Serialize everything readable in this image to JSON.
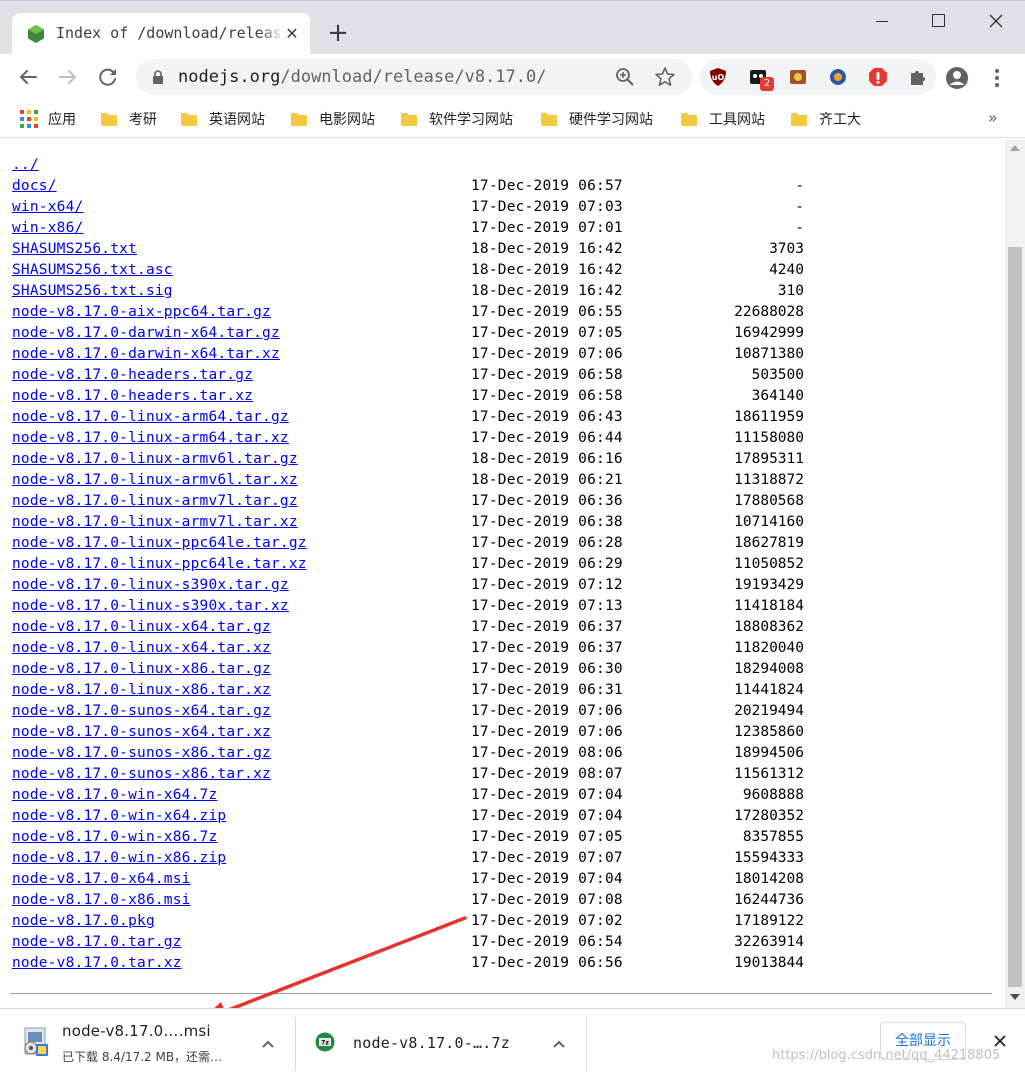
{
  "tab": {
    "title": "Index of /download/release/v8.17.0/",
    "close_icon": "close-icon",
    "favicon": "nodejs-icon"
  },
  "toolbar": {
    "url_host": "nodejs.org",
    "url_path": "/download/release/v8.17.0/",
    "extensions": [
      "ublock-origin-icon",
      "extension-icon",
      "extension-icon",
      "extension-icon",
      "adblock-icon",
      "puzzle-icon"
    ],
    "extension_badge": "2"
  },
  "bookmarks": {
    "apps_label": "应用",
    "items": [
      "考研",
      "英语网站",
      "电影网站",
      "软件学习网站",
      "硬件学习网站",
      "工具网站",
      "齐工大"
    ],
    "more": "»"
  },
  "listing": {
    "parent": "../",
    "rows": [
      {
        "name": "docs/",
        "date": "17-Dec-2019 06:57",
        "size": "-"
      },
      {
        "name": "win-x64/",
        "date": "17-Dec-2019 07:03",
        "size": "-"
      },
      {
        "name": "win-x86/",
        "date": "17-Dec-2019 07:01",
        "size": "-"
      },
      {
        "name": "SHASUMS256.txt",
        "date": "18-Dec-2019 16:42",
        "size": "3703"
      },
      {
        "name": "SHASUMS256.txt.asc",
        "date": "18-Dec-2019 16:42",
        "size": "4240"
      },
      {
        "name": "SHASUMS256.txt.sig",
        "date": "18-Dec-2019 16:42",
        "size": "310"
      },
      {
        "name": "node-v8.17.0-aix-ppc64.tar.gz",
        "date": "17-Dec-2019 06:55",
        "size": "22688028"
      },
      {
        "name": "node-v8.17.0-darwin-x64.tar.gz",
        "date": "17-Dec-2019 07:05",
        "size": "16942999"
      },
      {
        "name": "node-v8.17.0-darwin-x64.tar.xz",
        "date": "17-Dec-2019 07:06",
        "size": "10871380"
      },
      {
        "name": "node-v8.17.0-headers.tar.gz",
        "date": "17-Dec-2019 06:58",
        "size": "503500"
      },
      {
        "name": "node-v8.17.0-headers.tar.xz",
        "date": "17-Dec-2019 06:58",
        "size": "364140"
      },
      {
        "name": "node-v8.17.0-linux-arm64.tar.gz",
        "date": "17-Dec-2019 06:43",
        "size": "18611959"
      },
      {
        "name": "node-v8.17.0-linux-arm64.tar.xz",
        "date": "17-Dec-2019 06:44",
        "size": "11158080"
      },
      {
        "name": "node-v8.17.0-linux-armv6l.tar.gz",
        "date": "18-Dec-2019 06:16",
        "size": "17895311"
      },
      {
        "name": "node-v8.17.0-linux-armv6l.tar.xz",
        "date": "18-Dec-2019 06:21",
        "size": "11318872"
      },
      {
        "name": "node-v8.17.0-linux-armv7l.tar.gz",
        "date": "17-Dec-2019 06:36",
        "size": "17880568"
      },
      {
        "name": "node-v8.17.0-linux-armv7l.tar.xz",
        "date": "17-Dec-2019 06:38",
        "size": "10714160"
      },
      {
        "name": "node-v8.17.0-linux-ppc64le.tar.gz",
        "date": "17-Dec-2019 06:28",
        "size": "18627819"
      },
      {
        "name": "node-v8.17.0-linux-ppc64le.tar.xz",
        "date": "17-Dec-2019 06:29",
        "size": "11050852"
      },
      {
        "name": "node-v8.17.0-linux-s390x.tar.gz",
        "date": "17-Dec-2019 07:12",
        "size": "19193429"
      },
      {
        "name": "node-v8.17.0-linux-s390x.tar.xz",
        "date": "17-Dec-2019 07:13",
        "size": "11418184"
      },
      {
        "name": "node-v8.17.0-linux-x64.tar.gz",
        "date": "17-Dec-2019 06:37",
        "size": "18808362"
      },
      {
        "name": "node-v8.17.0-linux-x64.tar.xz",
        "date": "17-Dec-2019 06:37",
        "size": "11820040"
      },
      {
        "name": "node-v8.17.0-linux-x86.tar.gz",
        "date": "17-Dec-2019 06:30",
        "size": "18294008"
      },
      {
        "name": "node-v8.17.0-linux-x86.tar.xz",
        "date": "17-Dec-2019 06:31",
        "size": "11441824"
      },
      {
        "name": "node-v8.17.0-sunos-x64.tar.gz",
        "date": "17-Dec-2019 07:06",
        "size": "20219494"
      },
      {
        "name": "node-v8.17.0-sunos-x64.tar.xz",
        "date": "17-Dec-2019 07:06",
        "size": "12385860"
      },
      {
        "name": "node-v8.17.0-sunos-x86.tar.gz",
        "date": "17-Dec-2019 08:06",
        "size": "18994506"
      },
      {
        "name": "node-v8.17.0-sunos-x86.tar.xz",
        "date": "17-Dec-2019 08:07",
        "size": "11561312"
      },
      {
        "name": "node-v8.17.0-win-x64.7z",
        "date": "17-Dec-2019 07:04",
        "size": "9608888"
      },
      {
        "name": "node-v8.17.0-win-x64.zip",
        "date": "17-Dec-2019 07:04",
        "size": "17280352"
      },
      {
        "name": "node-v8.17.0-win-x86.7z",
        "date": "17-Dec-2019 07:05",
        "size": "8357855"
      },
      {
        "name": "node-v8.17.0-win-x86.zip",
        "date": "17-Dec-2019 07:07",
        "size": "15594333"
      },
      {
        "name": "node-v8.17.0-x64.msi",
        "date": "17-Dec-2019 07:04",
        "size": "18014208"
      },
      {
        "name": "node-v8.17.0-x86.msi",
        "date": "17-Dec-2019 07:08",
        "size": "16244736"
      },
      {
        "name": "node-v8.17.0.pkg",
        "date": "17-Dec-2019 07:02",
        "size": "17189122"
      },
      {
        "name": "node-v8.17.0.tar.gz",
        "date": "17-Dec-2019 06:54",
        "size": "32263914"
      },
      {
        "name": "node-v8.17.0.tar.xz",
        "date": "17-Dec-2019 06:56",
        "size": "19013844"
      }
    ]
  },
  "downloads": {
    "items": [
      {
        "name": "node-v8.17.0….msi",
        "status": "已下载 8.4/17.2 MB，还需…",
        "icon": "msi-installer-icon"
      },
      {
        "name": "node-v8.17.0-….7z",
        "status": "",
        "icon": "7zip-icon"
      }
    ],
    "show_all": "全部显示"
  },
  "watermark": "https://blog.csdn.net/qq_44218805",
  "colors": {
    "link": "#0000ee",
    "tabstrip": "#dee1e6",
    "annotation_arrow": "#e8322f",
    "accent": "#1a73e8"
  }
}
